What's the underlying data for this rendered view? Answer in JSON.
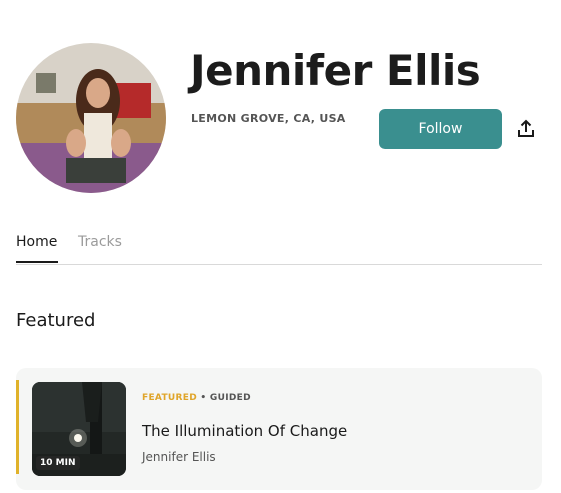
{
  "profile": {
    "name": "Jennifer Ellis",
    "location": "LEMON GROVE, CA, USA",
    "follow_label": "Follow"
  },
  "tabs": [
    {
      "label": "Home",
      "active": true
    },
    {
      "label": "Tracks",
      "active": false
    }
  ],
  "featured_section": {
    "title": "Featured",
    "items": [
      {
        "tag_featured": "FEATURED",
        "separator": "•",
        "tag_type": "GUIDED",
        "title": "The Illumination Of Change",
        "author": "Jennifer Ellis",
        "duration": "10 MIN"
      }
    ]
  },
  "icons": {
    "share": "share-upload-icon"
  },
  "colors": {
    "accent_teal": "#3a8f8f",
    "featured_gold": "#e0a52a",
    "card_background": "#f5f6f5"
  }
}
